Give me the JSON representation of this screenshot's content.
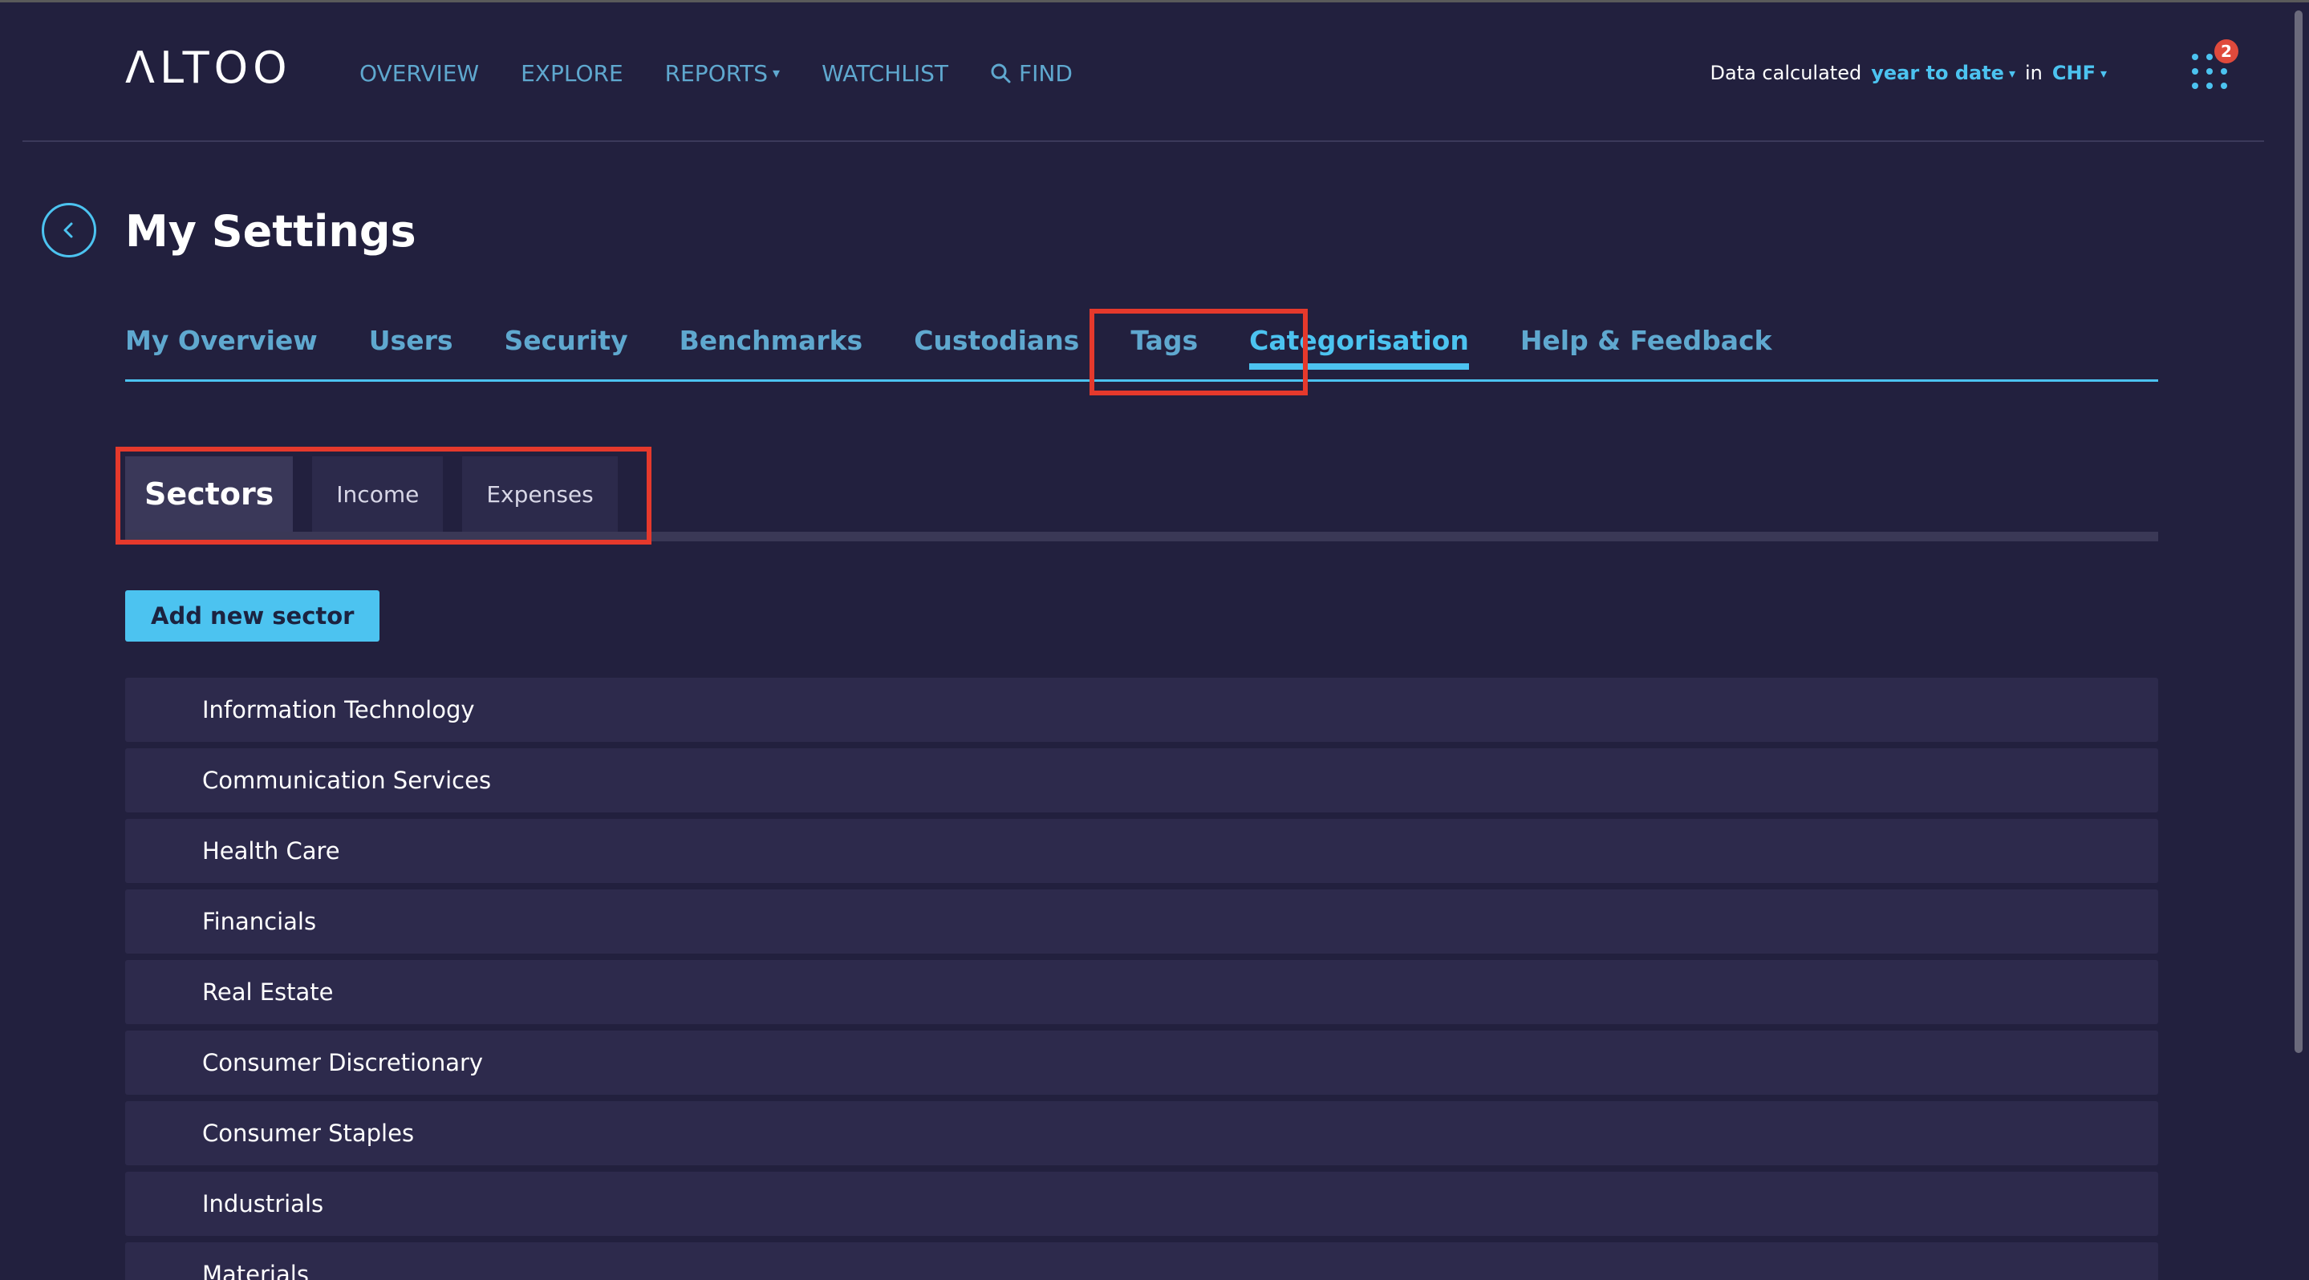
{
  "brand": {
    "logo_text": "ΛLTOO"
  },
  "nav": {
    "items": [
      {
        "label": "OVERVIEW",
        "has_caret": false
      },
      {
        "label": "EXPLORE",
        "has_caret": false
      },
      {
        "label": "REPORTS",
        "has_caret": true
      },
      {
        "label": "WATCHLIST",
        "has_caret": false
      }
    ],
    "find_label": "FIND"
  },
  "data_calc": {
    "prefix": "Data calculated",
    "period": "year to date",
    "in_label": "in",
    "currency": "CHF"
  },
  "apps": {
    "icon": "grid-dots-icon",
    "badge_count": "2"
  },
  "page": {
    "title": "My Settings"
  },
  "settings_tabs": [
    {
      "label": "My Overview",
      "active": false
    },
    {
      "label": "Users",
      "active": false
    },
    {
      "label": "Security",
      "active": false
    },
    {
      "label": "Benchmarks",
      "active": false
    },
    {
      "label": "Custodians",
      "active": false
    },
    {
      "label": "Tags",
      "active": false
    },
    {
      "label": "Categorisation",
      "active": true
    },
    {
      "label": "Help & Feedback",
      "active": false
    }
  ],
  "sub_tabs": [
    {
      "label": "Sectors",
      "active": true
    },
    {
      "label": "Income",
      "active": false
    },
    {
      "label": "Expenses",
      "active": false
    }
  ],
  "actions": {
    "add_sector_label": "Add new sector"
  },
  "sectors": [
    "Information Technology",
    "Communication Services",
    "Health Care",
    "Financials",
    "Real Estate",
    "Consumer Discretionary",
    "Consumer Staples",
    "Industrials",
    "Materials"
  ],
  "colors": {
    "background": "#22203e",
    "accent": "#4cc3f0",
    "link": "#5fa8cf",
    "highlight": "#e5392c",
    "badge": "#e04a3c"
  }
}
